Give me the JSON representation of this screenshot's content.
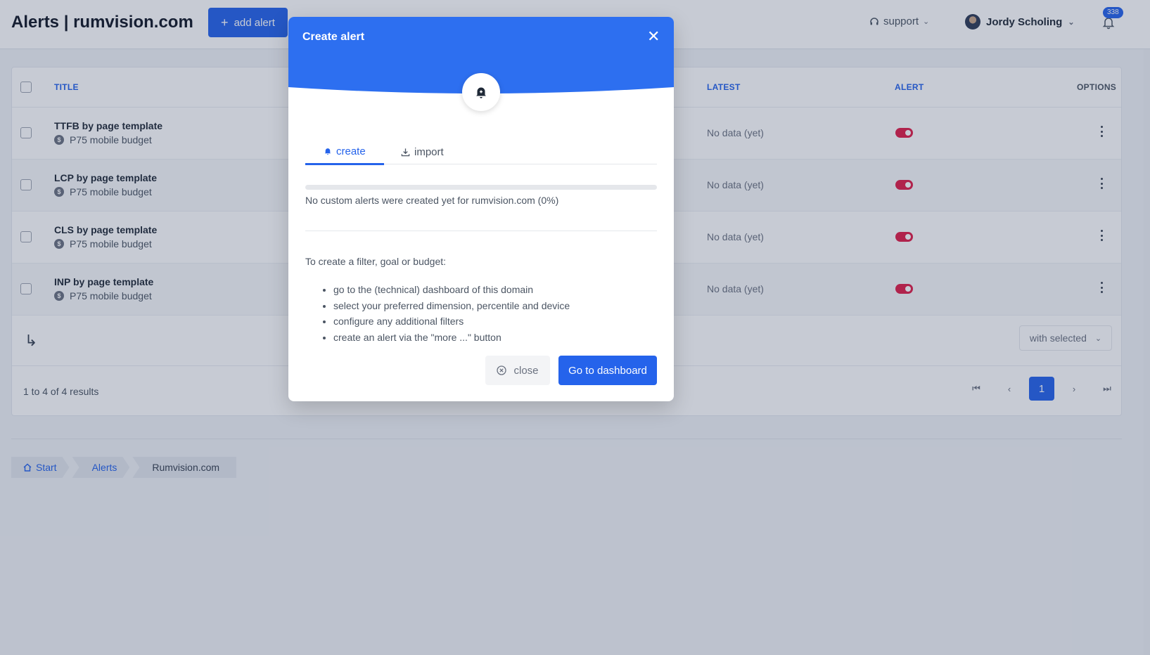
{
  "header": {
    "title": "Alerts | rumvision.com",
    "add_alert_label": "add alert",
    "support_label": "support",
    "user_name": "Jordy Scholing",
    "notification_count": "338"
  },
  "table": {
    "columns": {
      "title": "TITLE",
      "latest": "LATEST",
      "alert": "ALERT",
      "options": "OPTIONS"
    },
    "rows": [
      {
        "title": "TTFB by page template",
        "subtitle": "P75 mobile budget",
        "latest": "No data (yet)",
        "alert_enabled": true
      },
      {
        "title": "LCP by page template",
        "subtitle": "P75 mobile budget",
        "latest": "No data (yet)",
        "alert_enabled": true
      },
      {
        "title": "CLS by page template",
        "subtitle": "P75 mobile budget",
        "latest": "No data (yet)",
        "alert_enabled": true
      },
      {
        "title": "INP by page template",
        "subtitle": "P75 mobile budget",
        "latest": "No data (yet)",
        "alert_enabled": true
      }
    ],
    "with_selected_label": "with selected",
    "results_text": "1 to 4 of 4 results",
    "current_page": "1"
  },
  "breadcrumb": {
    "items": [
      "Start",
      "Alerts",
      "Rumvision.com"
    ]
  },
  "modal": {
    "title": "Create alert",
    "tabs": {
      "create": "create",
      "import": "import"
    },
    "progress_fraction": 0,
    "no_alerts_text": "No custom alerts were created yet for rumvision.com (0%)",
    "howto_text": "To create a filter, goal or budget:",
    "steps": [
      "go to the (technical) dashboard of this domain",
      "select your preferred dimension, percentile and device",
      "configure any additional filters",
      "create an alert via the \"more ...\" button"
    ],
    "close_label": "close",
    "go_label": "Go to dashboard"
  },
  "colors": {
    "accent": "#2563eb",
    "toggle_on": "#e11d48"
  },
  "icons": [
    "plus-icon",
    "headset-icon",
    "bell-icon",
    "dollar-icon",
    "kebab-icon",
    "return-arrow-icon",
    "home-icon",
    "download-icon",
    "close-circle-icon"
  ]
}
